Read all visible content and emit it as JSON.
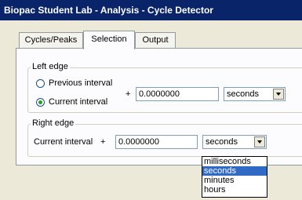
{
  "window": {
    "title": "Biopac Student Lab - Analysis - Cycle Detector"
  },
  "tabs": [
    {
      "label": "Cycles/Peaks"
    },
    {
      "label": "Selection"
    },
    {
      "label": "Output"
    }
  ],
  "left_edge": {
    "legend": "Left edge",
    "option_previous": "Previous interval",
    "option_current": "Current interval",
    "selected": "Current interval",
    "plus": "+",
    "value": "0.0000000",
    "unit": "seconds"
  },
  "right_edge": {
    "legend": "Right edge",
    "label": "Current interval",
    "plus": "+",
    "value": "0.0000000",
    "unit": "seconds",
    "unit_options": [
      "milliseconds",
      "seconds",
      "minutes",
      "hours"
    ],
    "highlighted": "seconds"
  }
}
